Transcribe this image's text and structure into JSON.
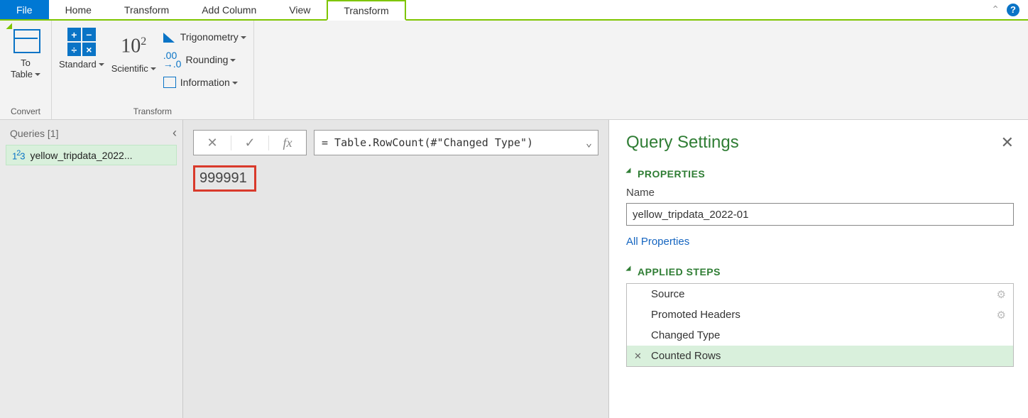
{
  "tabs": {
    "file": "File",
    "home": "Home",
    "transform": "Transform",
    "add_column": "Add Column",
    "view": "View",
    "context": "Transform"
  },
  "ribbon": {
    "convert": {
      "group_label": "Convert",
      "to_table_line1": "To",
      "to_table_line2": "Table"
    },
    "transform": {
      "group_label": "Transform",
      "standard": "Standard",
      "scientific": "Scientific",
      "sci_symbol": "10",
      "sci_exp": "2",
      "trig": "Trigonometry",
      "rounding": "Rounding",
      "information": "Information"
    }
  },
  "queries": {
    "header": "Queries [1]",
    "items": [
      {
        "label": "yellow_tripdata_2022..."
      }
    ]
  },
  "formula": {
    "text": "= Table.RowCount(#\"Changed Type\")"
  },
  "result": {
    "value": "999991"
  },
  "settings": {
    "title": "Query Settings",
    "properties_header": "PROPERTIES",
    "name_label": "Name",
    "name_value": "yellow_tripdata_2022-01",
    "all_properties": "All Properties",
    "steps_header": "APPLIED STEPS",
    "steps": [
      {
        "label": "Source",
        "gear": true,
        "selected": false
      },
      {
        "label": "Promoted Headers",
        "gear": true,
        "selected": false
      },
      {
        "label": "Changed Type",
        "gear": false,
        "selected": false
      },
      {
        "label": "Counted Rows",
        "gear": false,
        "selected": true
      }
    ]
  }
}
